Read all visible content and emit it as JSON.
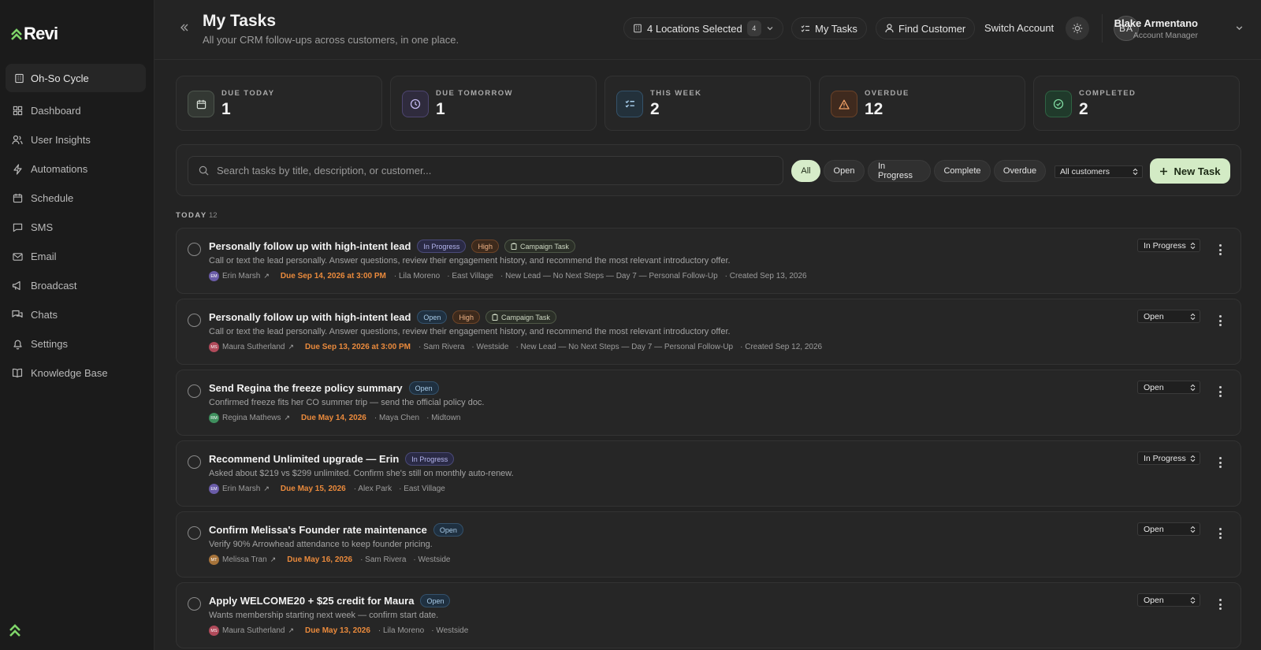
{
  "app": {
    "logo_text": "Revi"
  },
  "sidebar": {
    "org": "Oh-So Cycle",
    "items": [
      {
        "label": "Dashboard",
        "icon": "grid-icon"
      },
      {
        "label": "User Insights",
        "icon": "users-icon"
      },
      {
        "label": "Automations",
        "icon": "zap-icon"
      },
      {
        "label": "Schedule",
        "icon": "calendar-icon"
      },
      {
        "label": "SMS",
        "icon": "message-icon"
      },
      {
        "label": "Email",
        "icon": "mail-icon"
      },
      {
        "label": "Broadcast",
        "icon": "megaphone-icon"
      },
      {
        "label": "Chats",
        "icon": "chats-icon"
      },
      {
        "label": "Settings",
        "icon": "bell-icon"
      },
      {
        "label": "Knowledge Base",
        "icon": "book-icon"
      }
    ]
  },
  "header": {
    "title": "My Tasks",
    "subtitle": "All your CRM follow-ups across customers, in one place.",
    "locations_label": "4 Locations Selected",
    "locations_count": "4",
    "my_tasks_label": "My Tasks",
    "find_customer_label": "Find Customer",
    "switch_account_label": "Switch Account",
    "user": {
      "initials": "BA",
      "name": "Blake Armentano",
      "role": "Account Manager"
    }
  },
  "stats": [
    {
      "label": "DUE TODAY",
      "value": "1",
      "icon": "calendar-icon",
      "color": "#9aa39a"
    },
    {
      "label": "DUE TOMORROW",
      "value": "1",
      "icon": "clock-icon",
      "color": "#a79ad8"
    },
    {
      "label": "THIS WEEK",
      "value": "2",
      "icon": "list-check-icon",
      "color": "#7fb3d6"
    },
    {
      "label": "OVERDUE",
      "value": "12",
      "icon": "warning-icon",
      "color": "#e3884a"
    },
    {
      "label": "COMPLETED",
      "value": "2",
      "icon": "check-circle-icon",
      "color": "#6fca92"
    }
  ],
  "filters": {
    "search_placeholder": "Search tasks by title, description, or customer...",
    "buttons": [
      "All",
      "Open",
      "In Progress",
      "Complete",
      "Overdue"
    ],
    "active": "All",
    "customer_select": "All customers",
    "new_task_label": "New Task"
  },
  "section": {
    "label": "TODAY",
    "count": "12"
  },
  "tasks": [
    {
      "title": "Personally follow up with high-intent lead",
      "status_badge": "In Progress",
      "priority": "High",
      "campaign": "Campaign Task",
      "description": "Call or text the lead personally. Answer questions, review their engagement history, and recommend the most relevant introductory offer.",
      "owner_initials": "EM",
      "owner": "Erin Marsh",
      "owner_color": "#6a5ca8",
      "due": "Due Sep 14, 2026 at 3:00 PM",
      "meta": [
        "· Lila Moreno",
        "· East Village",
        "· New Lead — No Next Steps — Day 7 — Personal Follow-Up",
        "· Created Sep 13, 2026"
      ],
      "status": "In Progress"
    },
    {
      "title": "Personally follow up with high-intent lead",
      "status_badge": "Open",
      "priority": "High",
      "campaign": "Campaign Task",
      "description": "Call or text the lead personally. Answer questions, review their engagement history, and recommend the most relevant introductory offer.",
      "owner_initials": "MS",
      "owner": "Maura Sutherland",
      "owner_color": "#b04a5a",
      "due": "Due Sep 13, 2026 at 3:00 PM",
      "meta": [
        "· Sam Rivera",
        "· Westside",
        "· New Lead — No Next Steps — Day 7 — Personal Follow-Up",
        "· Created Sep 12, 2026"
      ],
      "status": "Open"
    },
    {
      "title": "Send Regina the freeze policy summary",
      "status_badge": "Open",
      "priority": "",
      "campaign": "",
      "description": "Confirmed freeze fits her CO summer trip — send the official policy doc.",
      "owner_initials": "RM",
      "owner": "Regina Mathews",
      "owner_color": "#3f8f5e",
      "due": "Due May 14, 2026",
      "meta": [
        "· Maya Chen",
        "· Midtown"
      ],
      "status": "Open"
    },
    {
      "title": "Recommend Unlimited upgrade — Erin",
      "status_badge": "In Progress",
      "priority": "",
      "campaign": "",
      "description": "Asked about $219 vs $299 unlimited. Confirm she's still on monthly auto-renew.",
      "owner_initials": "EM",
      "owner": "Erin Marsh",
      "owner_color": "#6a5ca8",
      "due": "Due May 15, 2026",
      "meta": [
        "· Alex Park",
        "· East Village"
      ],
      "status": "In Progress"
    },
    {
      "title": "Confirm Melissa's Founder rate maintenance",
      "status_badge": "Open",
      "priority": "",
      "campaign": "",
      "description": "Verify 90% Arrowhead attendance to keep founder pricing.",
      "owner_initials": "MT",
      "owner": "Melissa Tran",
      "owner_color": "#a6733a",
      "due": "Due May 16, 2026",
      "meta": [
        "· Sam Rivera",
        "· Westside"
      ],
      "status": "Open"
    },
    {
      "title": "Apply WELCOME20 + $25 credit for Maura",
      "status_badge": "Open",
      "priority": "",
      "campaign": "",
      "description": "Wants membership starting next week — confirm start date.",
      "owner_initials": "MS",
      "owner": "Maura Sutherland",
      "owner_color": "#b04a5a",
      "due": "Due May 13, 2026",
      "meta": [
        "· Lila Moreno",
        "· Westside"
      ],
      "status": "Open"
    }
  ]
}
